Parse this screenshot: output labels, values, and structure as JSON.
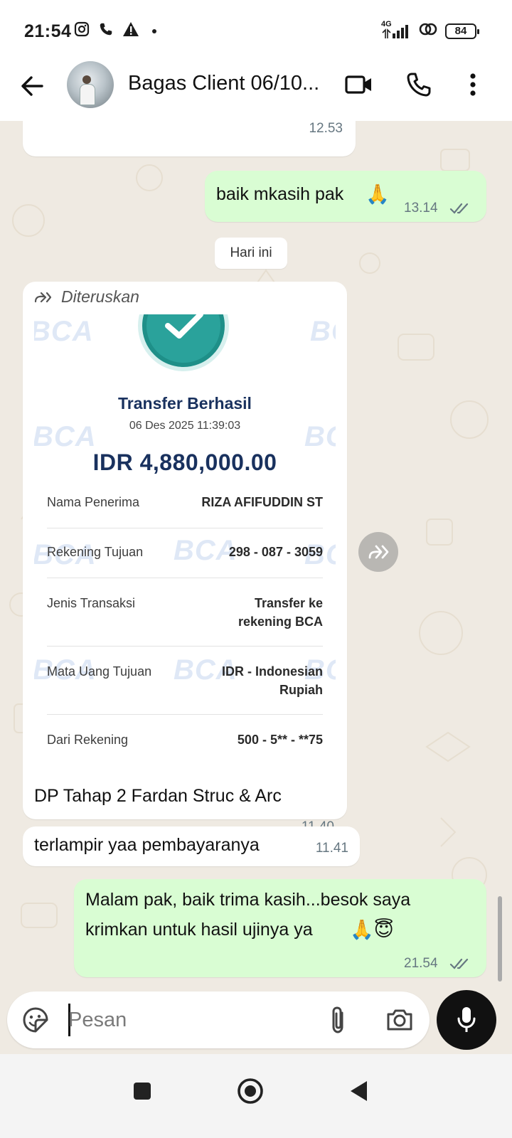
{
  "status_bar": {
    "time": "21:54",
    "network": "4G",
    "battery": "84"
  },
  "header": {
    "title": "Bagas Client 06/10...",
    "icons": [
      "back-arrow-icon",
      "video-call-icon",
      "phone-icon",
      "more-vert-icon"
    ]
  },
  "messages": {
    "m1": {
      "time": "12.53"
    },
    "m2": {
      "text": "baik mkasih pak",
      "emoji": "🙏",
      "time": "13.14"
    },
    "date_chip": "Hari ini",
    "m3": {
      "forwarded_label": "Diteruskan",
      "caption": "DP Tahap 2 Fardan Struc & Arc",
      "time": "11.40"
    },
    "m4": {
      "text": "terlampir yaa pembayaranya",
      "time": "11.41"
    },
    "m5": {
      "line1": "Malam pak, baik trima kasih...besok saya",
      "line2": "krimkan untuk hasil ujinya ya",
      "emojis": "🙏😇",
      "time": "21.54"
    }
  },
  "receipt": {
    "watermark": "BCA",
    "title": "Transfer Berhasil",
    "datetime": "06 Des 2025 11:39:03",
    "amount": "IDR 4,880,000.00",
    "rows": [
      {
        "label": "Nama Penerima",
        "value": "RIZA AFIFUDDIN ST"
      },
      {
        "label": "Rekening Tujuan",
        "value": "298 - 087 - 3059"
      },
      {
        "label": "Jenis Transaksi",
        "value_line1": "Transfer ke",
        "value_line2": "rekening BCA"
      },
      {
        "label": "Mata Uang Tujuan",
        "value_line1": "IDR - Indonesian",
        "value_line2": "Rupiah"
      },
      {
        "label": "Dari Rekening",
        "value": "500 - 5** - **75"
      }
    ]
  },
  "composer": {
    "placeholder": "Pesan"
  },
  "colors": {
    "chat_bg": "#efeae2",
    "outgoing_bubble": "#d9fdd3",
    "incoming_bubble": "#ffffff",
    "receipt_navy": "#19315e",
    "check_teal": "#2aa29b"
  }
}
